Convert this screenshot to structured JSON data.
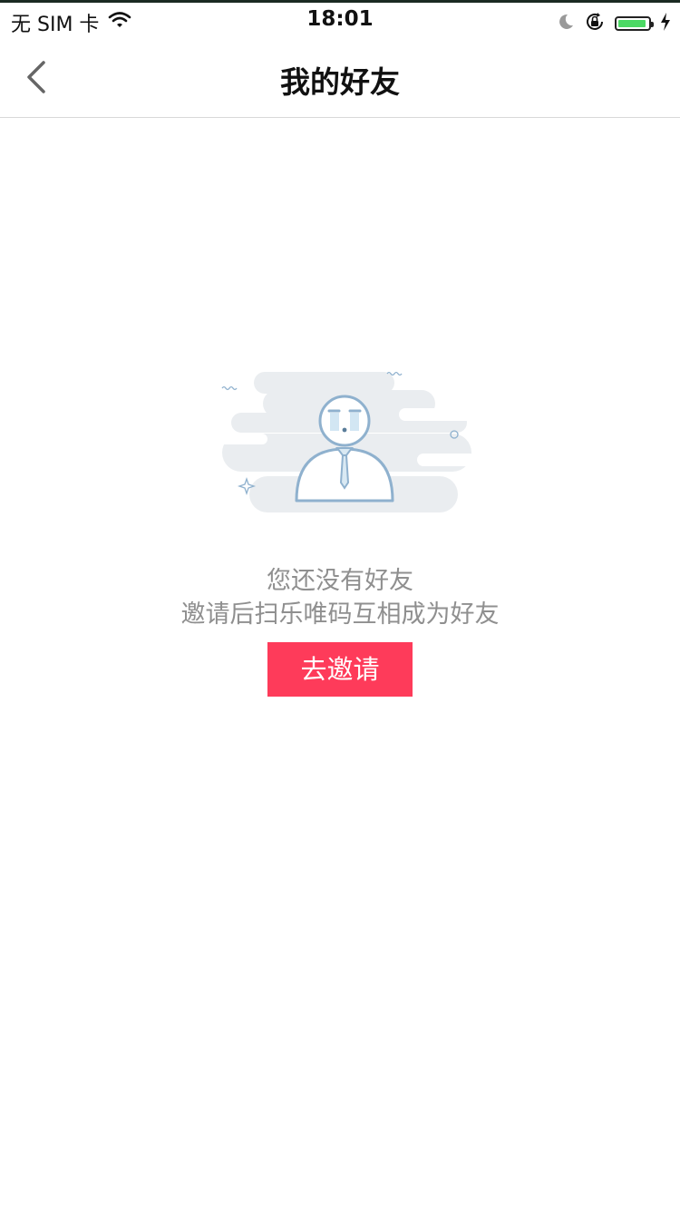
{
  "status_bar": {
    "carrier": "无 SIM 卡",
    "time": "18:01",
    "battery_level": 0.95,
    "battery_color": "#4cd964"
  },
  "nav": {
    "title": "我的好友",
    "back_icon": "chevron-left-icon"
  },
  "empty_state": {
    "illustration": "sad-person-illustration",
    "line1": "您还没有好友",
    "line2": "邀请后扫乐唯码互相成为好友"
  },
  "actions": {
    "invite_label": "去邀请",
    "invite_color": "#fe3b5a"
  }
}
